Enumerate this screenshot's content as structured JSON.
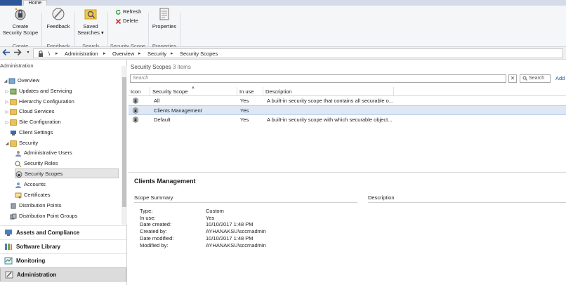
{
  "ribbon": {
    "tab": "Home",
    "buttons": {
      "create_security_scope": "Create\nSecurity Scope",
      "feedback": "Feedback",
      "saved_searches": "Saved\nSearches ▾",
      "refresh": "Refresh",
      "delete": "Delete",
      "properties": "Properties"
    },
    "groups": {
      "create": "Create",
      "feedback": "Feedback",
      "search": "Search",
      "security_scope": "Security Scope",
      "properties": "Properties"
    }
  },
  "address_bar": {
    "root": "\\",
    "crumbs": [
      "Administration",
      "Overview",
      "Security",
      "Security Scopes"
    ]
  },
  "nav": {
    "title": "Administration",
    "items": [
      {
        "label": "Overview",
        "icon": "overview-icon",
        "expander": "◢"
      },
      {
        "label": "Updates and Servicing",
        "icon": "updates-icon",
        "expander": "▷"
      },
      {
        "label": "Hierarchy Configuration",
        "icon": "folder-icon",
        "expander": "▷"
      },
      {
        "label": "Cloud Services",
        "icon": "folder-icon",
        "expander": "▷"
      },
      {
        "label": "Site Configuration",
        "icon": "folder-icon",
        "expander": "▷"
      },
      {
        "label": "Client Settings",
        "icon": "client-settings-icon",
        "expander": ""
      },
      {
        "label": "Security",
        "icon": "folder-icon",
        "expander": "◢"
      },
      {
        "label": "Administrative Users",
        "icon": "users-icon",
        "expander": ""
      },
      {
        "label": "Security Roles",
        "icon": "roles-icon",
        "expander": ""
      },
      {
        "label": "Security Scopes",
        "icon": "scopes-icon",
        "expander": ""
      },
      {
        "label": "Accounts",
        "icon": "accounts-icon",
        "expander": ""
      },
      {
        "label": "Certificates",
        "icon": "certificates-icon",
        "expander": ""
      },
      {
        "label": "Distribution Points",
        "icon": "distribution-points-icon",
        "expander": ""
      },
      {
        "label": "Distribution Point Groups",
        "icon": "distribution-groups-icon",
        "expander": ""
      }
    ],
    "workspaces": [
      "Assets and Compliance",
      "Software Library",
      "Monitoring",
      "Administration"
    ]
  },
  "list": {
    "title": "Security Scopes",
    "count": "3 items",
    "search_placeholder": "Search",
    "search_button": "Search",
    "add_criteria": "Add",
    "columns": [
      "Icon",
      "Security Scope",
      "In use",
      "Description"
    ],
    "rows": [
      {
        "name": "All",
        "in_use": "Yes",
        "description": "A built-in security scope that contains all securable o..."
      },
      {
        "name": "Clients Management",
        "in_use": "Yes",
        "description": ""
      },
      {
        "name": "Default",
        "in_use": "Yes",
        "description": "A built-in security scope with which securable object..."
      }
    ]
  },
  "detail": {
    "title": "Clients Management",
    "summary_header": "Scope Summary",
    "description_header": "Description",
    "fields": [
      {
        "k": "Type:",
        "v": "Custom"
      },
      {
        "k": "In use:",
        "v": "Yes"
      },
      {
        "k": "Date created:",
        "v": "10/10/2017 1:48 PM"
      },
      {
        "k": "Created by:",
        "v": "AYHANAKSU\\sccmadmin"
      },
      {
        "k": "Date modified:",
        "v": "10/10/2017 1:48 PM"
      },
      {
        "k": "Modified by:",
        "v": "AYHANAKSU\\sccmadmin"
      }
    ]
  },
  "colors": {
    "accent": "#2b579a",
    "selection": "#dde8f4",
    "folder": "#e8c25f"
  }
}
